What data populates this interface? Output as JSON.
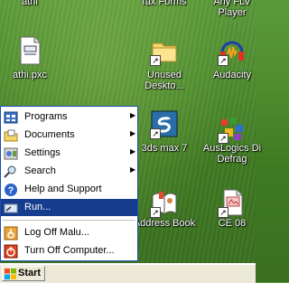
{
  "desktop": {
    "top_labels": {
      "left": "athi",
      "middle": "Tax Forms",
      "right_line1": "Any FLV",
      "right_line2": "Player"
    },
    "icons": [
      {
        "label": "athi.pxc",
        "icon": "file-icon"
      },
      {
        "label_line1": "Unused",
        "label_line2": "Deskto...",
        "icon": "folder-icon"
      },
      {
        "label": "Audacity",
        "icon": "headphones-icon"
      },
      {
        "label": "3ds max 7",
        "icon": "3dsmax-icon"
      },
      {
        "label_line1": "AusLogics Di",
        "label_line2": "Defrag",
        "icon": "defrag-icon"
      },
      {
        "label": "Address Book",
        "icon": "address-book-icon"
      },
      {
        "label": "CE 08",
        "icon": "document-icon"
      }
    ]
  },
  "start_menu": {
    "items": [
      {
        "label": "Programs",
        "icon": "programs-icon",
        "submenu": true
      },
      {
        "label": "Documents",
        "icon": "documents-icon",
        "submenu": true
      },
      {
        "label": "Settings",
        "icon": "settings-icon",
        "submenu": true
      },
      {
        "label": "Search",
        "icon": "search-icon",
        "submenu": true
      },
      {
        "label": "Help and Support",
        "icon": "help-icon",
        "submenu": false
      },
      {
        "label": "Run...",
        "icon": "run-icon",
        "submenu": false,
        "selected": true
      },
      {
        "label": "Log Off Malu...",
        "icon": "logoff-icon",
        "submenu": false
      },
      {
        "label": "Turn Off Computer...",
        "icon": "power-icon",
        "submenu": false
      }
    ],
    "selection_color": "#163c8d"
  },
  "taskbar": {
    "start_label": "Start"
  }
}
